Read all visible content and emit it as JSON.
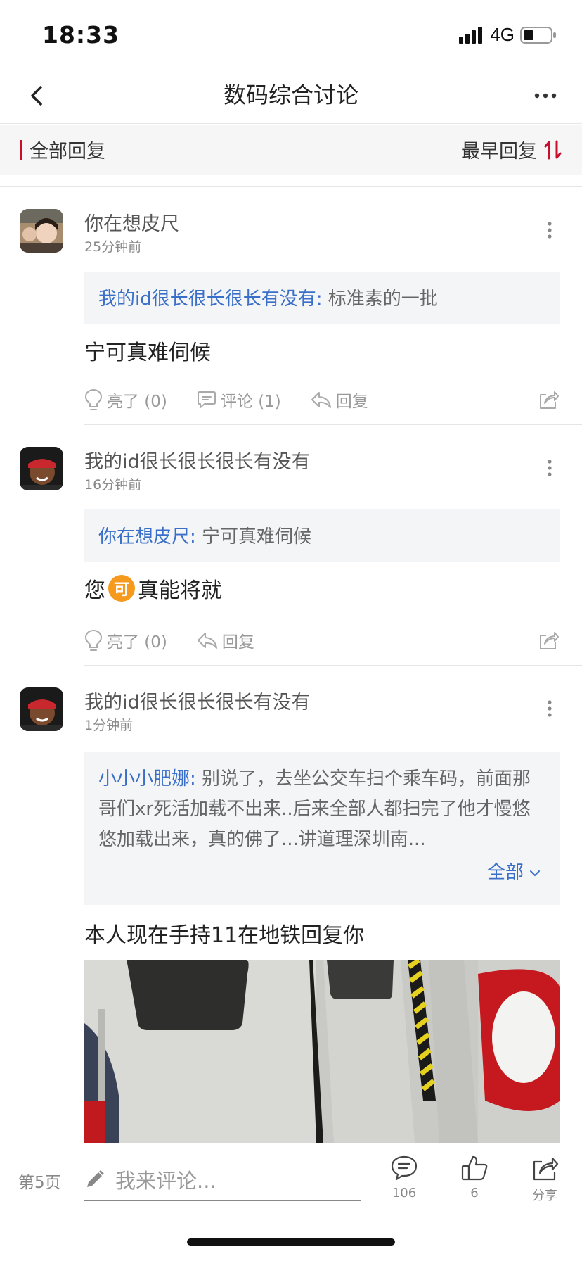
{
  "status": {
    "time": "18:33",
    "network": "4G"
  },
  "nav": {
    "title": "数码综合讨论"
  },
  "filter": {
    "all_replies": "全部回复",
    "sort": "最早回复",
    "accent": "#c8102e"
  },
  "posts": [
    {
      "author": "你在想皮尺",
      "time": "25分钟前",
      "quote_name": "我的id很长很长很长有没有:",
      "quote_text": " 标准素的一批",
      "text": "宁可真难伺候",
      "like": "亮了 (0)",
      "comment": "评论 (1)",
      "reply": "回复"
    },
    {
      "author": "我的id很长很长很长有没有",
      "time": "16分钟前",
      "quote_name": "你在想皮尺:",
      "quote_text": " 宁可真难伺候",
      "text_before": "您",
      "coin_char": "可",
      "text_after": "真能将就",
      "like": "亮了 (0)",
      "reply": "回复"
    },
    {
      "author": "我的id很长很长很长有没有",
      "time": "1分钟前",
      "quote_name": "小小小肥娜:",
      "quote_text": " 别说了，去坐公交车扫个乘车码，前面那哥们xr死活加载不出来..后来全部人都扫完了他才慢悠悠加载出来，真的佛了...讲道理深圳南...",
      "expand": "全部",
      "text": "本人现在手持11在地铁回复你"
    }
  ],
  "bottom": {
    "page": "第5页",
    "placeholder": "我来评论...",
    "comment_count": "106",
    "like_count": "6",
    "share": "分享"
  },
  "colors": {
    "link_blue": "#3a6fc9",
    "coin_orange": "#f59a1c"
  }
}
